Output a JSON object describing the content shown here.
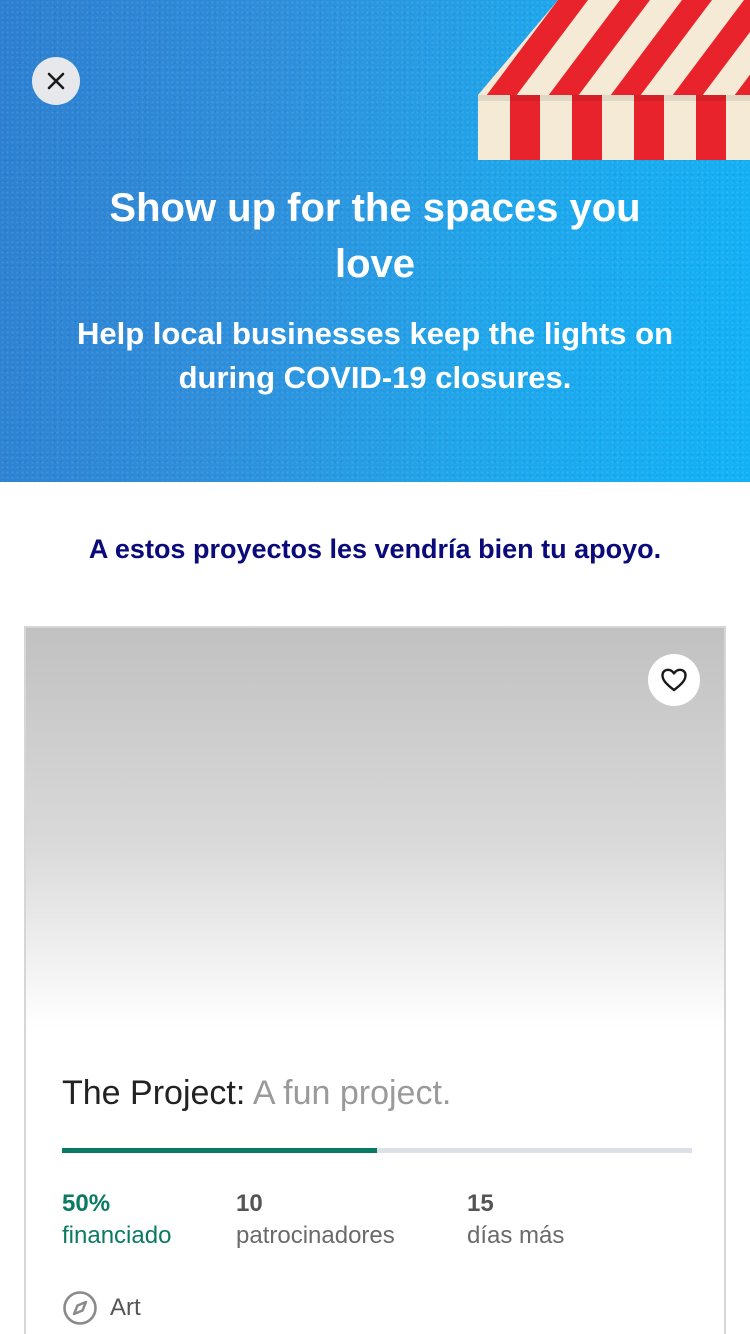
{
  "hero": {
    "title": "Show up for the spaces you love",
    "subtitle": "Help local businesses keep the lights on during COVID-19 closures.",
    "close_icon": "close-icon",
    "illustration": "striped-awning",
    "colors": {
      "start": "#2d7fd0",
      "end": "#12b2f7",
      "awning_red": "#e8232b",
      "awning_cream": "#f4ead6"
    }
  },
  "section": {
    "heading": "A estos proyectos les vendría bien tu apoyo."
  },
  "project": {
    "name": "The Project:",
    "blurb": "A fun project.",
    "favorite_icon": "heart-icon",
    "progress": 0.5,
    "stats": {
      "funded_value": "50%",
      "funded_label": "financiado",
      "backers_value": "10",
      "backers_label": "patrocinadores",
      "days_value": "15",
      "days_label": "días más"
    },
    "category_icon": "compass-icon",
    "category": "Art",
    "accent_color": "#0b7a62"
  }
}
